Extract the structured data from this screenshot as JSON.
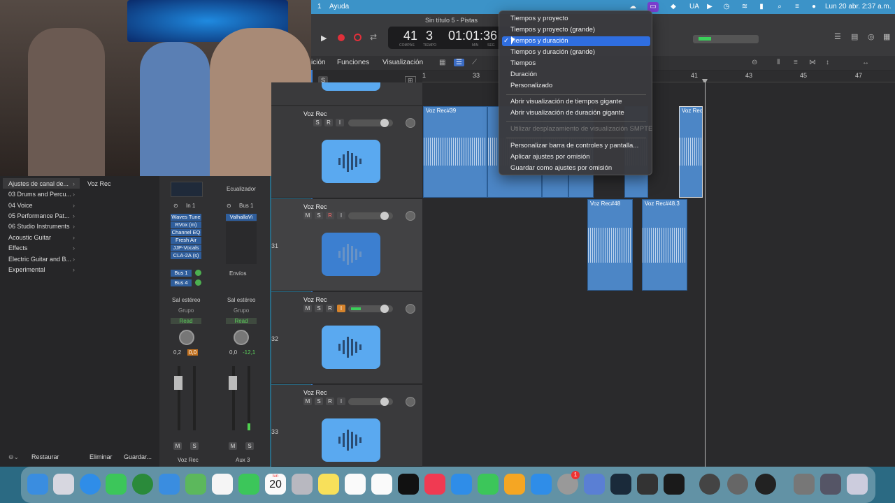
{
  "menubar": {
    "menu_number": "1",
    "help_menu": "Ayuda",
    "country": "UA",
    "datetime": "Lun 20 abr.  2:37 a.m."
  },
  "window": {
    "title": "Sin título 5 - Pistas",
    "lcd": {
      "bars": "41",
      "beats": "3",
      "bars_label": "COMPÁS",
      "beats_label": "TIEMPO",
      "time": "01:01:36",
      "min_label": "MIN",
      "sec_label": "SEG"
    }
  },
  "toolbar": {
    "edit_partial": "ición",
    "functions": "Funciones",
    "view": "Visualización"
  },
  "display_menu": {
    "items": [
      {
        "label": "Tiempos y proyecto",
        "state": "normal"
      },
      {
        "label": "Tiempos y proyecto (grande)",
        "state": "normal"
      },
      {
        "label": "Tiempos y duración",
        "state": "selected"
      },
      {
        "label": "Tiempos y duración (grande)",
        "state": "normal"
      },
      {
        "label": "Tiempos",
        "state": "normal"
      },
      {
        "label": "Duración",
        "state": "normal"
      },
      {
        "label": "Personalizado",
        "state": "normal"
      },
      {
        "label": "Abrir visualización de tiempos gigante",
        "state": "normal"
      },
      {
        "label": "Abrir visualización de duración gigante",
        "state": "normal"
      },
      {
        "label": "Utilizar desplazamiento de visualización SMPTE",
        "state": "disabled"
      },
      {
        "label": "Personalizar barra de controles y pantalla...",
        "state": "normal"
      },
      {
        "label": "Aplicar ajustes por omisión",
        "state": "normal"
      },
      {
        "label": "Guardar como ajustes por omisión",
        "state": "normal"
      }
    ],
    "check_mark": "✓"
  },
  "ruler": {
    "marks": [
      "1",
      "33",
      "41",
      "43",
      "45",
      "47"
    ]
  },
  "tracks": [
    {
      "name": "Voz Rec",
      "number": ""
    },
    {
      "name": "Voz Rec",
      "number": "31"
    },
    {
      "name": "Voz Rec",
      "number": "32"
    },
    {
      "name": "Voz Rec",
      "number": "33"
    }
  ],
  "track_buttons": {
    "m": "M",
    "s": "S",
    "r": "R",
    "i": "I"
  },
  "regions": [
    {
      "label": "Voz Rec#39"
    },
    {
      "label": "Voz Rec"
    },
    {
      "label": "Voz Rec#48"
    },
    {
      "label": "Voz Rec#48.3"
    }
  ],
  "library": {
    "header": "Ajustes de canal de...",
    "header_right": "Voz Rec",
    "items": [
      "03 Drums and Percu...",
      "04 Voice",
      "05 Performance Pat...",
      "06 Studio Instruments",
      "Acoustic Guitar",
      "Effects",
      "Electric Guitar and B...",
      "Experimental"
    ],
    "restore": "Restaurar",
    "delete": "Eliminar",
    "save": "Guardar..."
  },
  "strips": {
    "eq_label": "Ecualizador",
    "input1": "In 1",
    "input2": "Bus 1",
    "plugins": [
      "Waves Tune",
      "RVox (m)",
      "Channel EQ",
      "Fresh Air",
      "JJP-Vocals",
      "CLA-2A (s)"
    ],
    "plugin2": "ValhallaVi",
    "sends": [
      "Bus 1",
      "Bus 4"
    ],
    "sends_label": "Envíos",
    "output": "Sal estéreo",
    "group": "Grupo",
    "auto": "Read",
    "pan1": "0,2",
    "vol1": "0,0",
    "pan2": "0,0",
    "vol2": "-12,1",
    "name1": "Voz Rec",
    "name2": "Aux 3"
  },
  "dock": {
    "calendar_month": "lun",
    "calendar_day": "20",
    "mail_badge": "1"
  }
}
